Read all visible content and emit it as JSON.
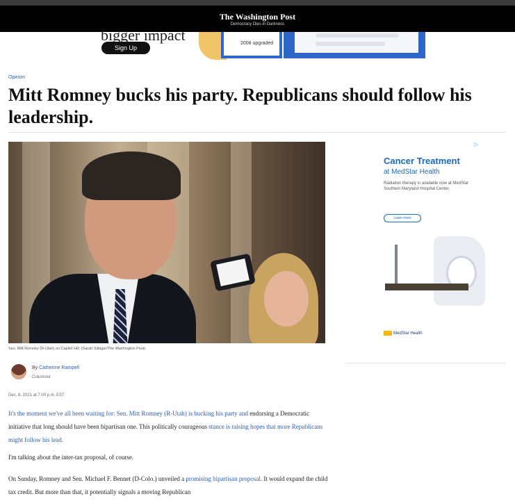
{
  "header": {
    "masthead": "The Washington Post",
    "tagline": "Democracy Dies in Darkness"
  },
  "top_ad": {
    "headline_fragment": "bigger impact",
    "signup_label": "Sign Up",
    "panel_label": "2008 upgraded"
  },
  "article": {
    "section": "Opinion",
    "title": "Mitt Romney bucks his party. Republicans should follow his leadership.",
    "photo_caption": "Sen. Mitt Romney (R-Utah) on Capitol Hill. (Sarah Silbiger/The Washington Post)",
    "byline_prefix": "By",
    "author": "Catherine Rampell",
    "author_role": "Columnist",
    "date": "Dec. 8, 2021 at 7:00 p.m. EST",
    "paragraphs": [
      {
        "lead_link": "It's the moment we've all been waiting for: Sen. Mitt Romney (R-Utah) is bucking his party and",
        "text": "endorsing a Democratic initiative that long should have been bipartisan one. This politically courageous",
        "tail_link": "stance is raising hopes that more Republicans might follow his lead."
      },
      {
        "text": "I'm talking about the inter-tax proposal, of course."
      },
      {
        "text": "On Sunday, Romney and Sen. Michael F. Bennet (D-Colo.) unveiled a",
        "link": "promising bipartisan proposal",
        "text_end": ". It would expand the child tax credit. But more than that, it potentially signals a moving Republican"
      }
    ]
  },
  "side_ad": {
    "adchoice": "▷",
    "headline": "Cancer Treatment",
    "subhead": "at MedStar Health",
    "body": "Radiation therapy is available now at MedStar Southern Maryland Hospital Center.",
    "button": "Learn more",
    "brand": "MedStar Health",
    "brand_color": "#1b6ab4"
  }
}
